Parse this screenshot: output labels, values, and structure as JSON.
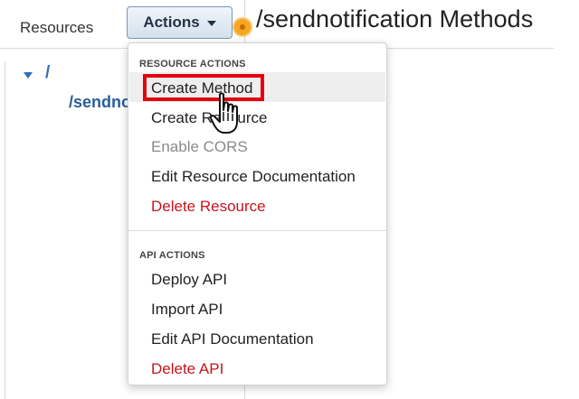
{
  "sidebar": {
    "title": "Resources",
    "tree": [
      {
        "label": "/"
      },
      {
        "label": "/sendnotification"
      }
    ]
  },
  "toolbar": {
    "actions_label": "Actions"
  },
  "page": {
    "title": "/sendnotification Methods"
  },
  "menu": {
    "resource_actions_header": "RESOURCE ACTIONS",
    "resource_actions": [
      {
        "label": "Create Method",
        "state": "hover"
      },
      {
        "label": "Create Resource",
        "state": "normal"
      },
      {
        "label": "Enable CORS",
        "state": "disabled"
      },
      {
        "label": "Edit Resource Documentation",
        "state": "normal"
      },
      {
        "label": "Delete Resource",
        "state": "danger"
      }
    ],
    "api_actions_header": "API ACTIONS",
    "api_actions": [
      {
        "label": "Deploy API",
        "state": "normal"
      },
      {
        "label": "Import API",
        "state": "normal"
      },
      {
        "label": "Edit API Documentation",
        "state": "normal"
      },
      {
        "label": "Delete API",
        "state": "danger"
      }
    ]
  },
  "colors": {
    "link": "#2a6ebb",
    "danger": "#c4161c",
    "highlight_box": "#e3000f",
    "status_dot": "#f5a623"
  },
  "icons": {
    "tree_toggle": "caret-down-icon",
    "dropdown": "caret-down-icon",
    "status": "status-dot-icon",
    "cursor": "hand-pointer-icon"
  }
}
